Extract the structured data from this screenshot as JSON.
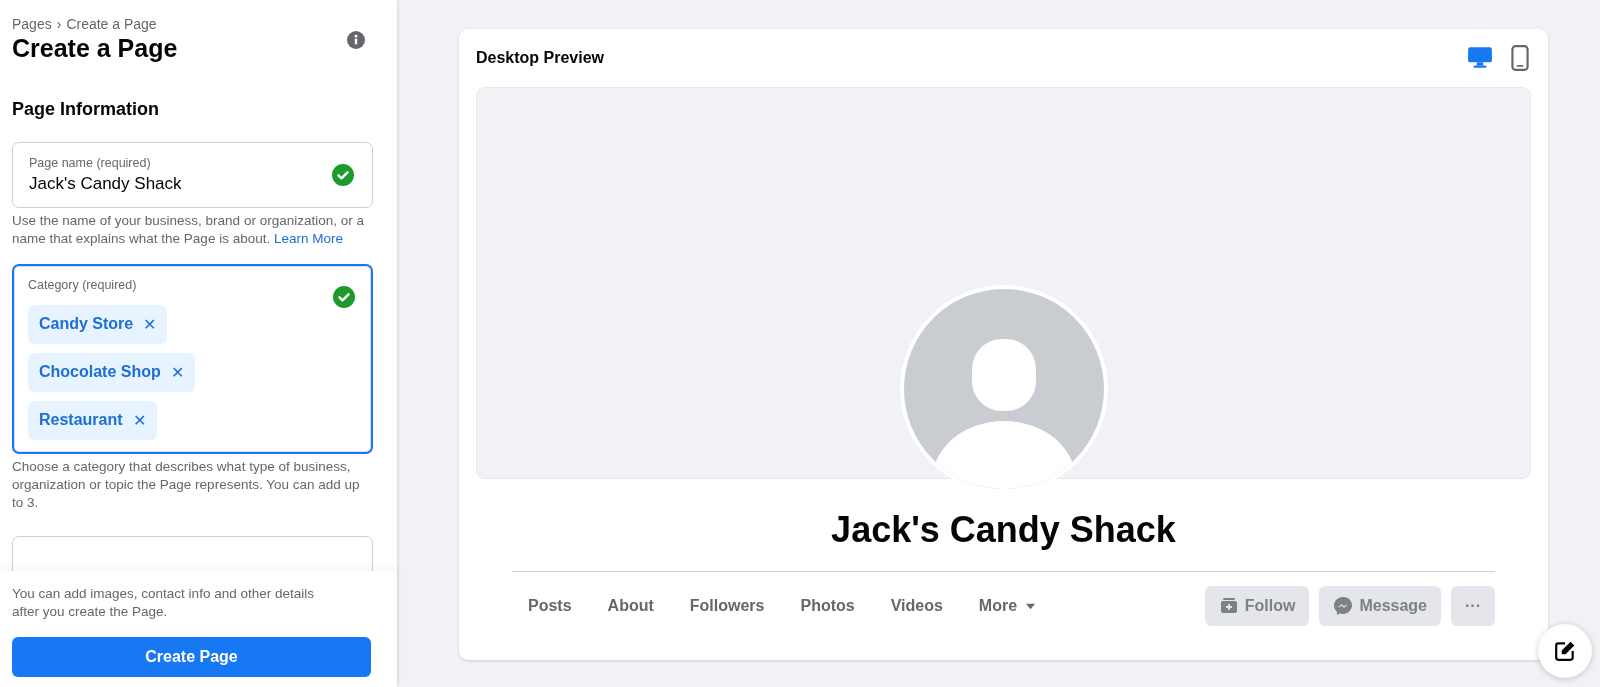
{
  "sidebar": {
    "breadcrumb": [
      "Pages",
      "Create a Page"
    ],
    "breadcrumb_separator": "›",
    "title": "Create a Page",
    "section_title": "Page Information",
    "fields": [
      {
        "kind": "text",
        "label": "Page name (required)",
        "value": "Jack's Candy Shack",
        "valid": true,
        "focused": false,
        "help": "Use the name of your business, brand or organization, or a name that explains what the Page is about.",
        "help_link": "Learn More"
      },
      {
        "kind": "tags",
        "label": "Category (required)",
        "tags": [
          "Candy Store",
          "Chocolate Shop",
          "Restaurant"
        ],
        "tag_remove": "✕",
        "valid": true,
        "focused": true,
        "help": "Choose a category that describes what type of business, organization or topic the Page represents. You can add up to 3."
      },
      {
        "kind": "cut"
      }
    ],
    "footer_text": "You can add images, contact info and other details after you create the Page.",
    "create_button": "Create Page"
  },
  "preview": {
    "title": "Desktop Preview",
    "devices": [
      {
        "kind": "desktop",
        "selected": true
      },
      {
        "kind": "mobile",
        "selected": false
      }
    ],
    "page_name": "Jack's Candy Shack",
    "tabs": [
      {
        "label": "Posts"
      },
      {
        "label": "About"
      },
      {
        "label": "Followers"
      },
      {
        "label": "Photos"
      },
      {
        "label": "Videos"
      },
      {
        "label": "More",
        "dropdown": true
      }
    ],
    "actions": [
      {
        "kind": "follow",
        "label": "Follow",
        "disabled": true
      },
      {
        "kind": "message",
        "label": "Message",
        "disabled": true
      },
      {
        "kind": "more",
        "label": "···",
        "disabled": true
      }
    ]
  }
}
